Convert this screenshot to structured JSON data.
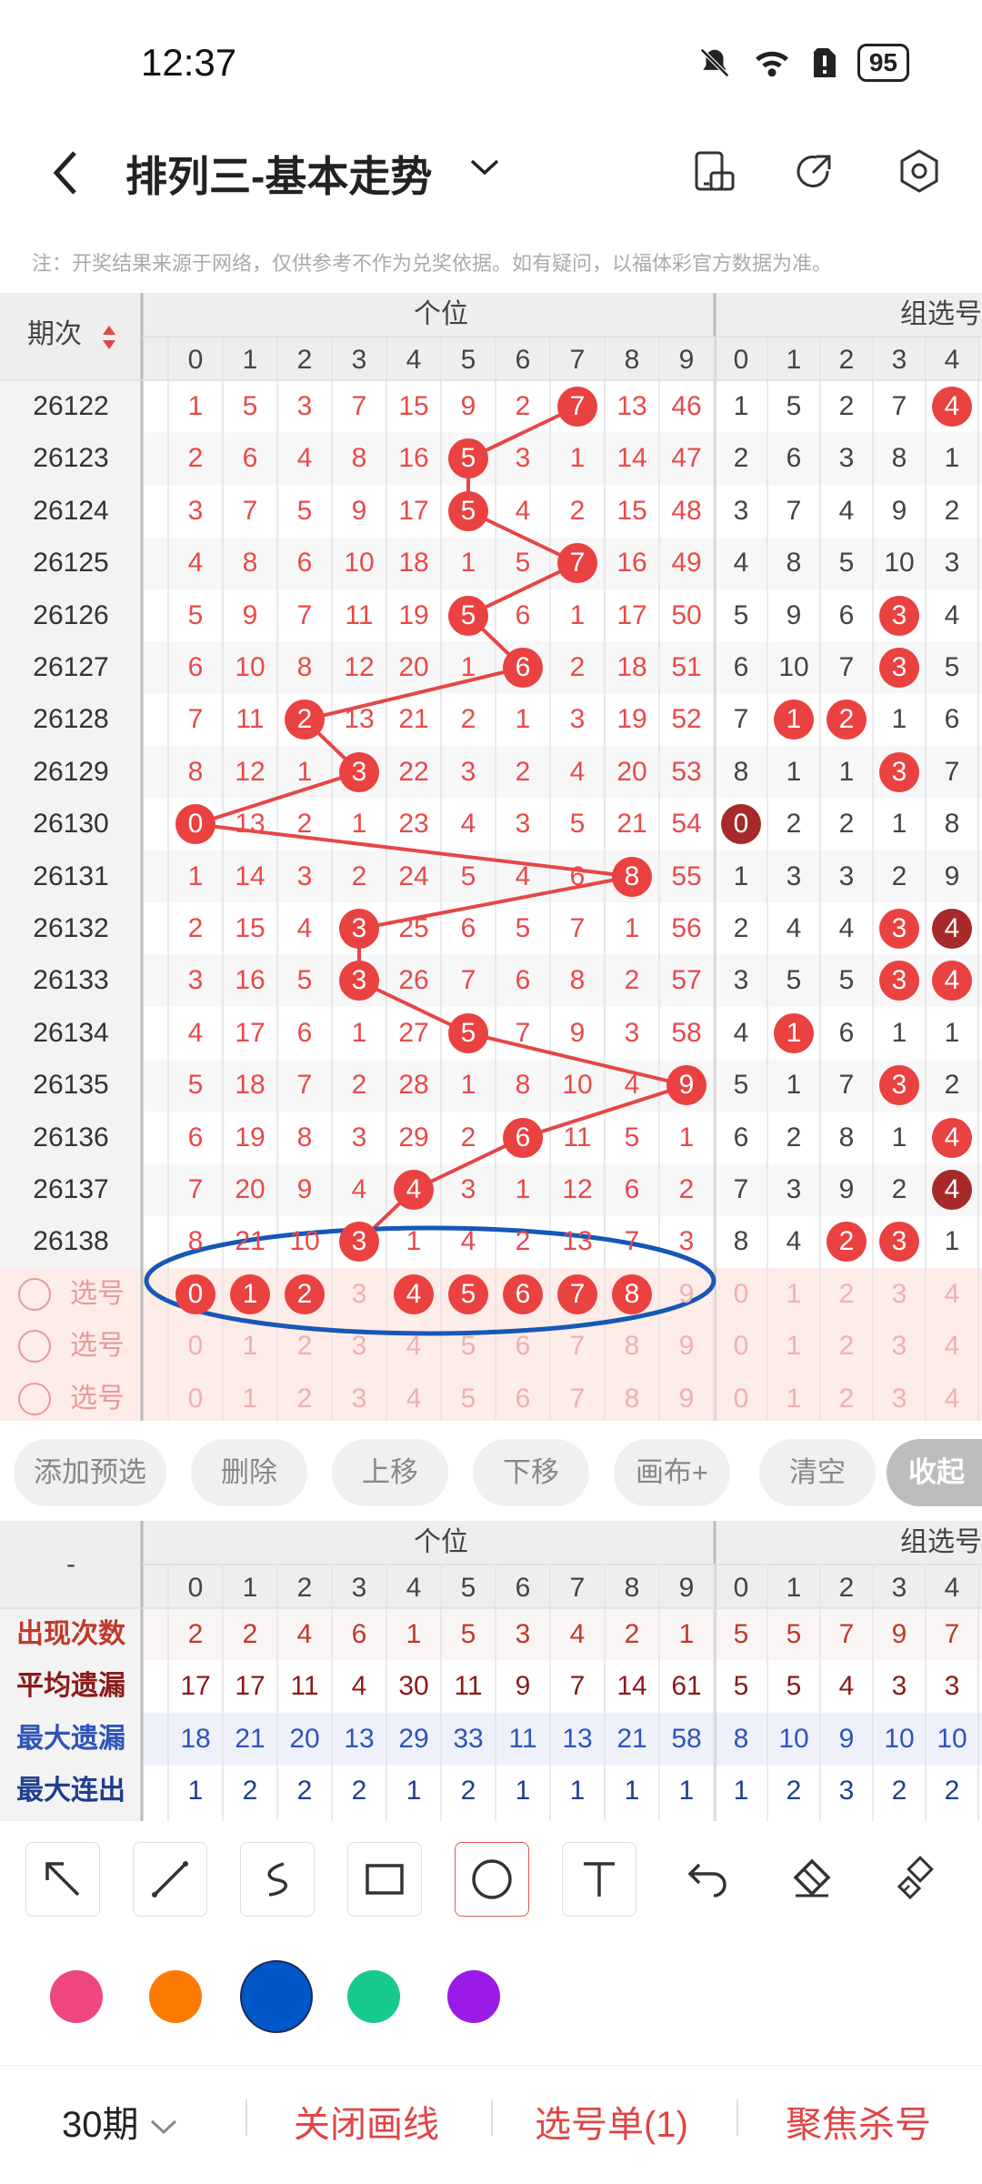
{
  "status_bar": {
    "time": "12:37",
    "battery": "95"
  },
  "header": {
    "title": "排列三-基本走势",
    "notice": "注：开奖结果来源于网络，仅供参考不作为兑奖依据。如有疑问，以福体彩官方数据为准。"
  },
  "table": {
    "period_header": "期次",
    "group1_header": "个位",
    "group2_header": "组选号",
    "digits": [
      "0",
      "1",
      "2",
      "3",
      "4",
      "5",
      "6",
      "7",
      "8",
      "9"
    ],
    "group2_digits": [
      "0",
      "1",
      "2",
      "3",
      "4"
    ],
    "rows": [
      {
        "period": "26122",
        "vals": [
          "1",
          "5",
          "3",
          "7",
          "15",
          "9",
          "2",
          "7",
          "13",
          "46"
        ],
        "hit": 7,
        "g2": [
          "1",
          "5",
          "2",
          "7",
          "4"
        ],
        "g2hit": [
          4
        ],
        "g2dark": []
      },
      {
        "period": "26123",
        "vals": [
          "2",
          "6",
          "4",
          "8",
          "16",
          "5",
          "3",
          "1",
          "14",
          "47"
        ],
        "hit": 5,
        "g2": [
          "2",
          "6",
          "3",
          "8",
          "1"
        ],
        "g2hit": [],
        "g2dark": []
      },
      {
        "period": "26124",
        "vals": [
          "3",
          "7",
          "5",
          "9",
          "17",
          "5",
          "4",
          "2",
          "15",
          "48"
        ],
        "hit": 5,
        "g2": [
          "3",
          "7",
          "4",
          "9",
          "2"
        ],
        "g2hit": [],
        "g2dark": []
      },
      {
        "period": "26125",
        "vals": [
          "4",
          "8",
          "6",
          "10",
          "18",
          "1",
          "5",
          "7",
          "16",
          "49"
        ],
        "hit": 7,
        "g2": [
          "4",
          "8",
          "5",
          "10",
          "3"
        ],
        "g2hit": [],
        "g2dark": []
      },
      {
        "period": "26126",
        "vals": [
          "5",
          "9",
          "7",
          "11",
          "19",
          "5",
          "6",
          "1",
          "17",
          "50"
        ],
        "hit": 5,
        "g2": [
          "5",
          "9",
          "6",
          "3",
          "4"
        ],
        "g2hit": [
          3
        ],
        "g2dark": []
      },
      {
        "period": "26127",
        "vals": [
          "6",
          "10",
          "8",
          "12",
          "20",
          "1",
          "6",
          "2",
          "18",
          "51"
        ],
        "hit": 6,
        "g2": [
          "6",
          "10",
          "7",
          "3",
          "5"
        ],
        "g2hit": [
          3
        ],
        "g2dark": []
      },
      {
        "period": "26128",
        "vals": [
          "7",
          "11",
          "2",
          "13",
          "21",
          "2",
          "1",
          "3",
          "19",
          "52"
        ],
        "hit": 2,
        "g2": [
          "7",
          "1",
          "2",
          "1",
          "6"
        ],
        "g2hit": [
          1,
          2
        ],
        "g2dark": []
      },
      {
        "period": "26129",
        "vals": [
          "8",
          "12",
          "1",
          "3",
          "22",
          "3",
          "2",
          "4",
          "20",
          "53"
        ],
        "hit": 3,
        "g2": [
          "8",
          "1",
          "1",
          "3",
          "7"
        ],
        "g2hit": [
          3
        ],
        "g2dark": []
      },
      {
        "period": "26130",
        "vals": [
          "0",
          "13",
          "2",
          "1",
          "23",
          "4",
          "3",
          "5",
          "21",
          "54"
        ],
        "hit": 0,
        "g2": [
          "0",
          "2",
          "2",
          "1",
          "8"
        ],
        "g2hit": [],
        "g2dark": [
          0
        ]
      },
      {
        "period": "26131",
        "vals": [
          "1",
          "14",
          "3",
          "2",
          "24",
          "5",
          "4",
          "6",
          "8",
          "55"
        ],
        "hit": 8,
        "g2": [
          "1",
          "3",
          "3",
          "2",
          "9"
        ],
        "g2hit": [],
        "g2dark": []
      },
      {
        "period": "26132",
        "vals": [
          "2",
          "15",
          "4",
          "3",
          "25",
          "6",
          "5",
          "7",
          "1",
          "56"
        ],
        "hit": 3,
        "g2": [
          "2",
          "4",
          "4",
          "3",
          "4"
        ],
        "g2hit": [
          3
        ],
        "g2dark": [
          4
        ]
      },
      {
        "period": "26133",
        "vals": [
          "3",
          "16",
          "5",
          "3",
          "26",
          "7",
          "6",
          "8",
          "2",
          "57"
        ],
        "hit": 3,
        "g2": [
          "3",
          "5",
          "5",
          "3",
          "4"
        ],
        "g2hit": [
          3,
          4
        ],
        "g2dark": []
      },
      {
        "period": "26134",
        "vals": [
          "4",
          "17",
          "6",
          "1",
          "27",
          "5",
          "7",
          "9",
          "3",
          "58"
        ],
        "hit": 5,
        "g2": [
          "4",
          "1",
          "6",
          "1",
          "1"
        ],
        "g2hit": [
          1
        ],
        "g2dark": []
      },
      {
        "period": "26135",
        "vals": [
          "5",
          "18",
          "7",
          "2",
          "28",
          "1",
          "8",
          "10",
          "4",
          "9"
        ],
        "hit": 9,
        "g2": [
          "5",
          "1",
          "7",
          "3",
          "2"
        ],
        "g2hit": [
          3
        ],
        "g2dark": []
      },
      {
        "period": "26136",
        "vals": [
          "6",
          "19",
          "8",
          "3",
          "29",
          "2",
          "6",
          "11",
          "5",
          "1"
        ],
        "hit": 6,
        "g2": [
          "6",
          "2",
          "8",
          "1",
          "4"
        ],
        "g2hit": [
          4
        ],
        "g2dark": []
      },
      {
        "period": "26137",
        "vals": [
          "7",
          "20",
          "9",
          "4",
          "4",
          "3",
          "1",
          "12",
          "6",
          "2"
        ],
        "hit": 4,
        "g2": [
          "7",
          "3",
          "9",
          "2",
          "4"
        ],
        "g2hit": [],
        "g2dark": [
          4
        ]
      },
      {
        "period": "26138",
        "vals": [
          "8",
          "21",
          "10",
          "3",
          "1",
          "4",
          "2",
          "13",
          "7",
          "3"
        ],
        "hit": 3,
        "g2": [
          "8",
          "4",
          "2",
          "3",
          "1"
        ],
        "g2hit": [
          2,
          3
        ],
        "g2dark": []
      }
    ],
    "select_label": "选号",
    "select_rows": [
      {
        "selected": [
          0,
          1,
          2,
          4,
          5,
          6,
          7,
          8
        ]
      },
      {
        "selected": []
      },
      {
        "selected": []
      }
    ]
  },
  "actions": [
    "添加预选",
    "删除",
    "上移",
    "下移",
    "画布+",
    "清空",
    "收起"
  ],
  "stats": {
    "dash": "-",
    "group1_header": "个位",
    "group2_header": "组选号",
    "rows": [
      {
        "label": "出现次数",
        "color": "#c0392b",
        "vals": [
          "2",
          "2",
          "4",
          "6",
          "1",
          "5",
          "3",
          "4",
          "2",
          "1"
        ],
        "g2": [
          "5",
          "5",
          "7",
          "9",
          "7"
        ]
      },
      {
        "label": "平均遗漏",
        "color": "#8b1a1a",
        "vals": [
          "17",
          "17",
          "11",
          "4",
          "30",
          "11",
          "9",
          "7",
          "14",
          "61"
        ],
        "g2": [
          "5",
          "5",
          "4",
          "3",
          "3"
        ]
      },
      {
        "label": "最大遗漏",
        "color": "#2f55b8",
        "vals": [
          "18",
          "21",
          "20",
          "13",
          "29",
          "33",
          "11",
          "13",
          "21",
          "58"
        ],
        "g2": [
          "8",
          "10",
          "9",
          "10",
          "10"
        ]
      },
      {
        "label": "最大连出",
        "color": "#1f3f8f",
        "vals": [
          "1",
          "2",
          "2",
          "2",
          "1",
          "2",
          "1",
          "1",
          "1",
          "1"
        ],
        "g2": [
          "1",
          "2",
          "3",
          "2",
          "2"
        ]
      }
    ]
  },
  "tools": [
    "arrow-tool",
    "line-tool",
    "curve-tool",
    "rect-tool",
    "circle-tool",
    "text-tool",
    "undo-tool",
    "eraser-tool",
    "clear-tool"
  ],
  "palette": [
    "#f0467e",
    "#ff7a00",
    "#0057c8",
    "#18c98f",
    "#9a1be6"
  ],
  "bottom": {
    "period_select": "30期",
    "close_lines": "关闭画线",
    "selection": "选号单(1)",
    "focus_kill": "聚焦杀号"
  }
}
